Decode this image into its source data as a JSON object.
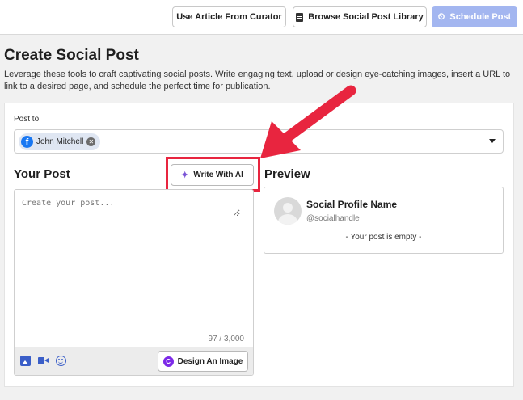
{
  "topbar": {
    "curator_label": "Use Article From Curator",
    "library_label": "Browse Social Post Library",
    "schedule_label": "Schedule Post"
  },
  "header": {
    "title": "Create Social Post",
    "description": "Leverage these tools to craft captivating social posts. Write engaging text, upload or design eye-catching images, insert a URL to link to a desired page, and schedule the perfect time for publication."
  },
  "post_to": {
    "label": "Post to:",
    "selected_account": "John Mitchell",
    "account_icon": "facebook-icon"
  },
  "your_post": {
    "title": "Your Post",
    "ai_button_label": "Write With AI",
    "placeholder": "Create your post...",
    "char_count": "97 / 3,000",
    "design_button_label": "Design An Image",
    "toolbar_icons": [
      "image-icon",
      "video-icon",
      "emoji-icon"
    ]
  },
  "preview": {
    "title": "Preview",
    "profile_name": "Social Profile Name",
    "profile_handle": "@socialhandle",
    "empty_message": "- Your post is empty -"
  },
  "colors": {
    "accent": "#3a5ec8",
    "schedule_button": "#a3b6f0",
    "highlight": "#e8253f",
    "facebook": "#1877f2",
    "canva": "#7d2ae8"
  }
}
